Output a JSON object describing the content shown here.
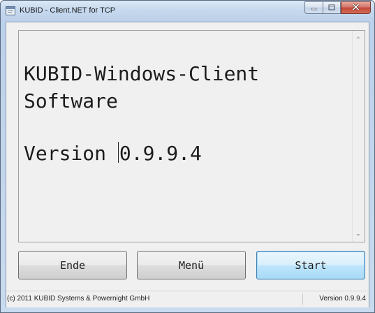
{
  "window": {
    "title": "KUBID - Client.NET for TCP"
  },
  "display": {
    "line1": "KUBID-Windows-Client",
    "line2": "Software",
    "version_prefix": "Version ",
    "version_value": "0.9.9.4"
  },
  "buttons": {
    "ende": "Ende",
    "menu": "Menü",
    "start": "Start"
  },
  "status": {
    "copyright": "(c) 2011 KUBID Systems & Powernight GmbH",
    "version": "Version 0.9.9.4"
  },
  "icons": {
    "app": "app-window-icon",
    "minimize": "minimize-icon",
    "maximize": "maximize-icon",
    "close": "close-icon"
  },
  "colors": {
    "title_bar": "#c5d8ee",
    "close_button": "#c0463a",
    "start_button_accent": "#3c7fb1"
  }
}
